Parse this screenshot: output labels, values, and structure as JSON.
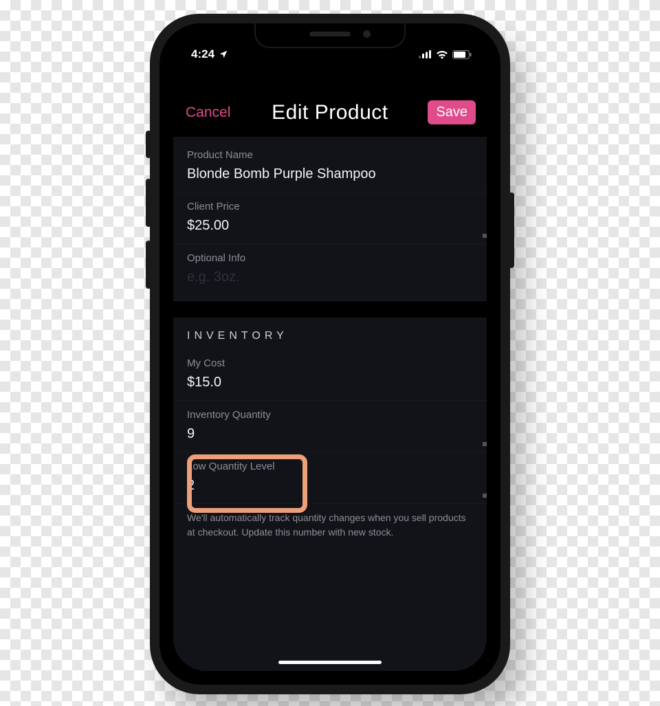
{
  "status": {
    "time": "4:24",
    "location_icon": "location-arrow",
    "signal_icon": "cellular-3",
    "wifi_icon": "wifi-3",
    "battery_icon": "battery-70"
  },
  "nav": {
    "cancel_label": "Cancel",
    "title": "Edit Product",
    "save_label": "Save"
  },
  "fields": {
    "product_name": {
      "label": "Product Name",
      "value": "Blonde Bomb Purple Shampoo"
    },
    "client_price": {
      "label": "Client Price",
      "value": "$25.00"
    },
    "optional_info": {
      "label": "Optional Info",
      "placeholder": "e.g. 3oz.",
      "value": ""
    }
  },
  "inventory": {
    "header": "INVENTORY",
    "my_cost": {
      "label": "My Cost",
      "value": "$15.0"
    },
    "quantity": {
      "label": "Inventory Quantity",
      "value": "9"
    },
    "low_level": {
      "label": "Low Quantity Level",
      "value": "2"
    },
    "note": "We'll automatically track quantity changes when you sell products at checkout. Update this number with new stock."
  },
  "colors": {
    "accent": "#e04b8a",
    "highlight": "#ed9f7a"
  }
}
